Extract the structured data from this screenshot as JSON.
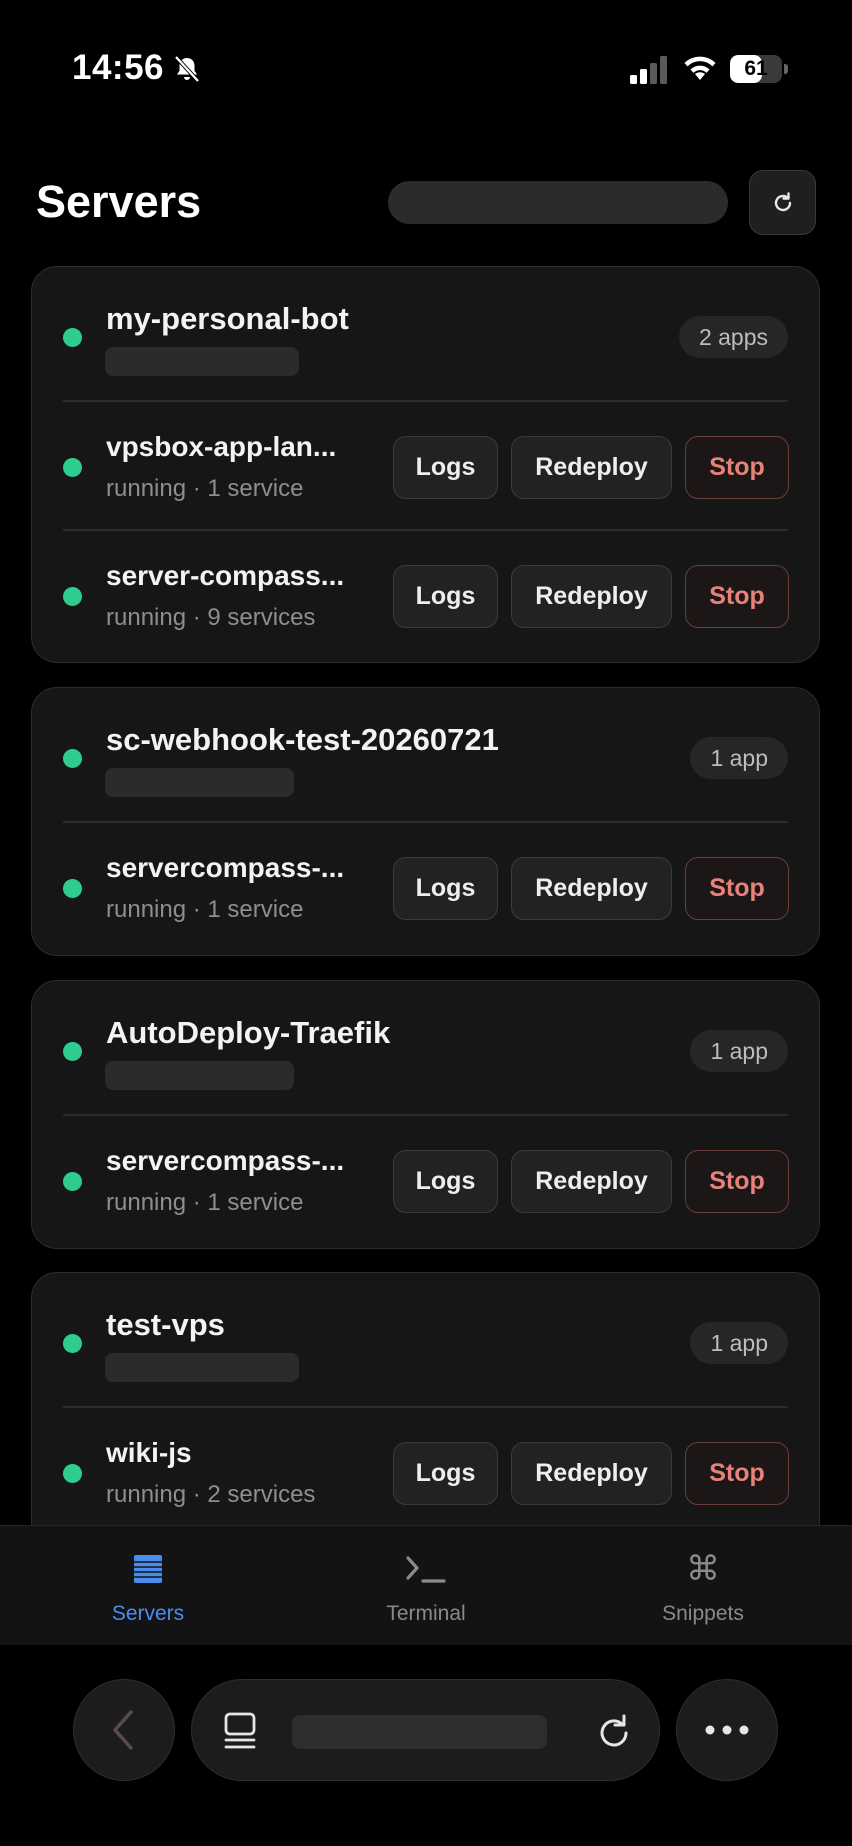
{
  "status_bar": {
    "time": "14:56",
    "battery": "61",
    "battery_level": 0.61
  },
  "header": {
    "title": "Servers"
  },
  "servers": [
    {
      "name": "my-personal-bot",
      "badge": "2 apps",
      "apps": [
        {
          "name": "vpsbox-app-lan...",
          "status": "running · 1 service"
        },
        {
          "name": "server-compass...",
          "status": "running · 9 services"
        }
      ]
    },
    {
      "name": "sc-webhook-test-20260721",
      "badge": "1 app",
      "apps": [
        {
          "name": "servercompass-...",
          "status": "running · 1 service"
        }
      ]
    },
    {
      "name": "AutoDeploy-Traefik",
      "badge": "1 app",
      "apps": [
        {
          "name": "servercompass-...",
          "status": "running · 1 service"
        }
      ]
    },
    {
      "name": "test-vps",
      "badge": "1 app",
      "apps": [
        {
          "name": "wiki-js",
          "status": "running · 2 services"
        }
      ]
    }
  ],
  "actions": {
    "logs": "Logs",
    "redeploy": "Redeploy",
    "stop": "Stop"
  },
  "tabs": [
    {
      "label": "Servers",
      "icon": "server-stack-icon",
      "active": true
    },
    {
      "label": "Terminal",
      "icon": "terminal-icon",
      "active": false
    },
    {
      "label": "Snippets",
      "icon": "command-icon",
      "active": false
    }
  ],
  "colors": {
    "status_running": "#2ecc8f",
    "stop": "#e7827a",
    "active_tab": "#4a8cf0"
  }
}
